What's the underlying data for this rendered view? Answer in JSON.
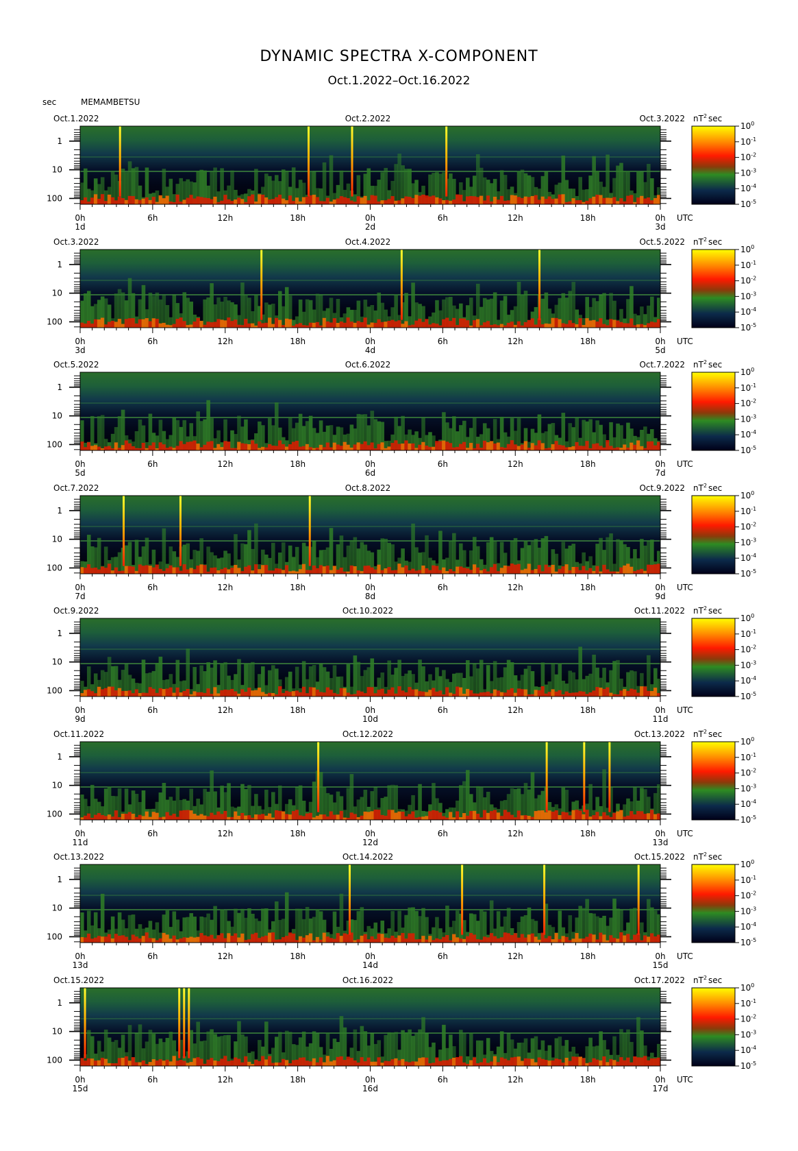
{
  "title": "DYNAMIC SPECTRA X-COMPONENT",
  "subtitle": "Oct.1.2022–Oct.16.2022",
  "header": {
    "unit": "sec",
    "station": "MEMAMBETSU"
  },
  "chart_data": {
    "type": "heatmap",
    "y_axis": {
      "label": "sec",
      "scale": "log",
      "tick_labels": [
        "1",
        "10",
        "100"
      ],
      "inverted": true
    },
    "x_axis": {
      "tick_labels": [
        "0h",
        "6h",
        "12h",
        "18h",
        "0h",
        "6h",
        "12h",
        "18h",
        "0h"
      ],
      "suffix": "UTC"
    },
    "colorbar": {
      "unit": "nT",
      "unit_exp": "2",
      "unit_suffix": "sec",
      "levels": [
        "10^0",
        "10^-1",
        "10^-2",
        "10^-3",
        "10^-4",
        "10^-5"
      ],
      "colors": [
        "#ffff00",
        "#ff8000",
        "#ff1a00",
        "#2e8b22",
        "#0a1a3a",
        "#000018"
      ]
    },
    "panels": [
      {
        "date_left": "Oct.1.2022",
        "date_mid": "Oct.2.2022",
        "date_right": "Oct.3.2022",
        "day_left": "1d",
        "day_mid": "2d",
        "day_right": "3d",
        "spikes_hours": [
          3.3,
          18.9,
          22.5,
          30.3
        ]
      },
      {
        "date_left": "Oct.3.2022",
        "date_mid": "Oct.4.2022",
        "date_right": "Oct.5.2022",
        "day_left": "3d",
        "day_mid": "4d",
        "day_right": "5d",
        "spikes_hours": [
          15.0,
          26.6,
          38.0
        ]
      },
      {
        "date_left": "Oct.5.2022",
        "date_mid": "Oct.6.2022",
        "date_right": "Oct.7.2022",
        "day_left": "5d",
        "day_mid": "6d",
        "day_right": "7d",
        "spikes_hours": []
      },
      {
        "date_left": "Oct.7.2022",
        "date_mid": "Oct.8.2022",
        "date_right": "Oct.9.2022",
        "day_left": "7d",
        "day_mid": "8d",
        "day_right": "9d",
        "spikes_hours": [
          3.6,
          8.3,
          19.0
        ]
      },
      {
        "date_left": "Oct.9.2022",
        "date_mid": "Oct.10.2022",
        "date_right": "Oct.11.2022",
        "day_left": "9d",
        "day_mid": "10d",
        "day_right": "11d",
        "spikes_hours": []
      },
      {
        "date_left": "Oct.11.2022",
        "date_mid": "Oct.12.2022",
        "date_right": "Oct.13.2022",
        "day_left": "11d",
        "day_mid": "12d",
        "day_right": "13d",
        "spikes_hours": [
          19.7,
          38.6,
          41.7,
          43.8
        ]
      },
      {
        "date_left": "Oct.13.2022",
        "date_mid": "Oct.14.2022",
        "date_right": "Oct.15.2022",
        "day_left": "13d",
        "day_mid": "14d",
        "day_right": "15d",
        "spikes_hours": [
          22.3,
          31.6,
          38.4,
          46.2
        ]
      },
      {
        "date_left": "Oct.15.2022",
        "date_mid": "Oct.16.2022",
        "date_right": "Oct.17.2022",
        "day_left": "15d",
        "day_mid": "16d",
        "day_right": "17d",
        "spikes_hours": [
          0.4,
          8.2,
          8.6,
          9.0
        ]
      }
    ]
  }
}
